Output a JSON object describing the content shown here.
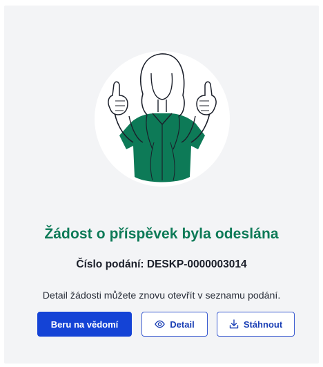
{
  "success": {
    "title": "Žádost o příspěvek byla odeslána",
    "submission_label": "Číslo podání: DESKP-0000003014",
    "description": "Detail žádosti můžete znovu otevřít v seznamu podání."
  },
  "actions": {
    "acknowledge_label": "Beru na vědomí",
    "detail_label": "Detail",
    "detail_icon": "eye-icon",
    "download_label": "Stáhnout",
    "download_icon": "download-icon"
  },
  "colors": {
    "accent_green": "#0d7a57",
    "primary_blue": "#1443d6",
    "card_background": "#f3f4f6"
  }
}
